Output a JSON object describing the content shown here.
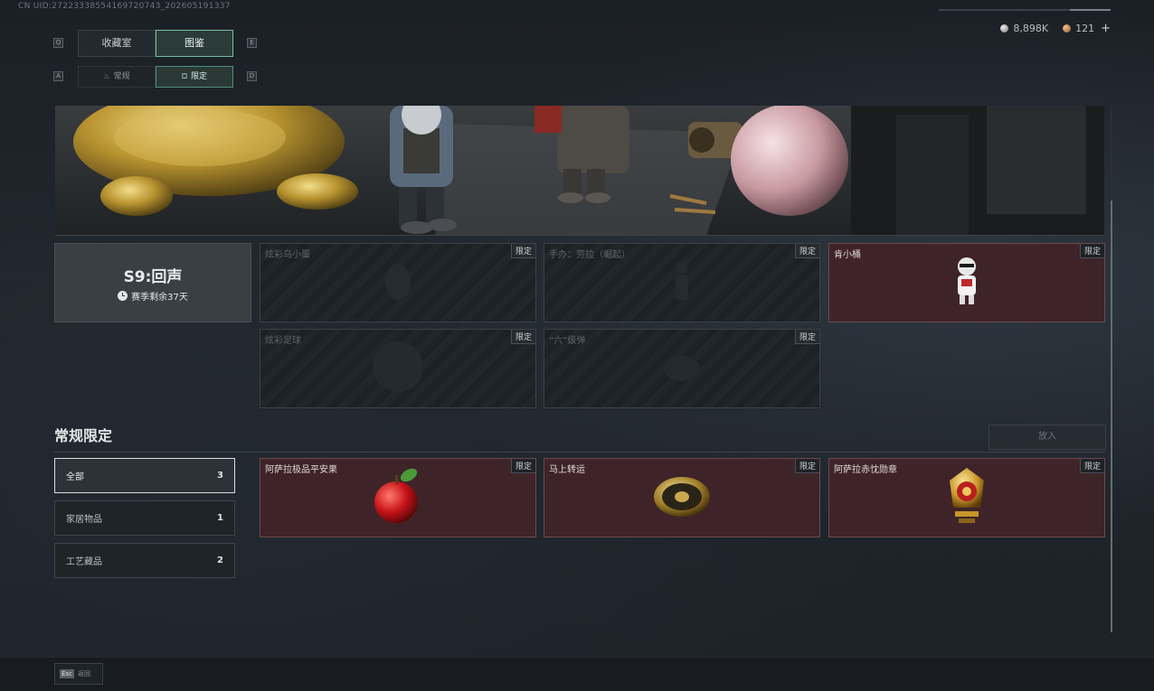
{
  "uid_text": "CN UID:27223338554169720743_202605191337",
  "currencies": [
    {
      "icon": "silver-coin-icon",
      "value": "8,898K"
    },
    {
      "icon": "bronze-coin-icon",
      "value": "121"
    }
  ],
  "plus_label": "+",
  "key_hints": {
    "q": "Q",
    "e": "E",
    "a": "A",
    "d": "D"
  },
  "main_tabs": [
    {
      "label": "收藏室",
      "active": false
    },
    {
      "label": "图鉴",
      "active": true
    }
  ],
  "sub_tabs": [
    {
      "label": "常规",
      "icon": "flame-icon",
      "active": false
    },
    {
      "label": "限定",
      "icon": "gift-icon",
      "active": true
    }
  ],
  "season": {
    "title": "S9:回声",
    "subtitle": "赛季剩余37天"
  },
  "season_items": [
    {
      "name": "炫彩乌小蛋",
      "tag": "限定",
      "state": "locked"
    },
    {
      "name": "手办：劳拉（崛起）",
      "tag": "限定",
      "state": "locked"
    },
    {
      "name": "肯小桶",
      "tag": "限定",
      "state": "owned"
    },
    {
      "name": "炫彩足球",
      "tag": "限定",
      "state": "locked"
    },
    {
      "name": "“六”级弹",
      "tag": "限定",
      "state": "locked"
    }
  ],
  "section_title": "常规限定",
  "put_in_label": "放入",
  "filters": [
    {
      "label": "全部",
      "count": "3",
      "active": true
    },
    {
      "label": "家居物品",
      "count": "1",
      "active": false
    },
    {
      "label": "工艺藏品",
      "count": "2",
      "active": false
    }
  ],
  "regular_items": [
    {
      "name": "阿萨拉极品平安果",
      "tag": "限定",
      "icon": "apple-icon"
    },
    {
      "name": "马上转运",
      "tag": "限定",
      "icon": "compass-disc-icon"
    },
    {
      "name": "阿萨拉赤忱勋章",
      "tag": "限定",
      "icon": "medal-icon"
    }
  ],
  "esc": {
    "key": "Esc",
    "label": "返回"
  },
  "colors": {
    "accent": "#6ec0a5",
    "owned_card": "#3e2428",
    "locked_card": "#1c2125"
  }
}
